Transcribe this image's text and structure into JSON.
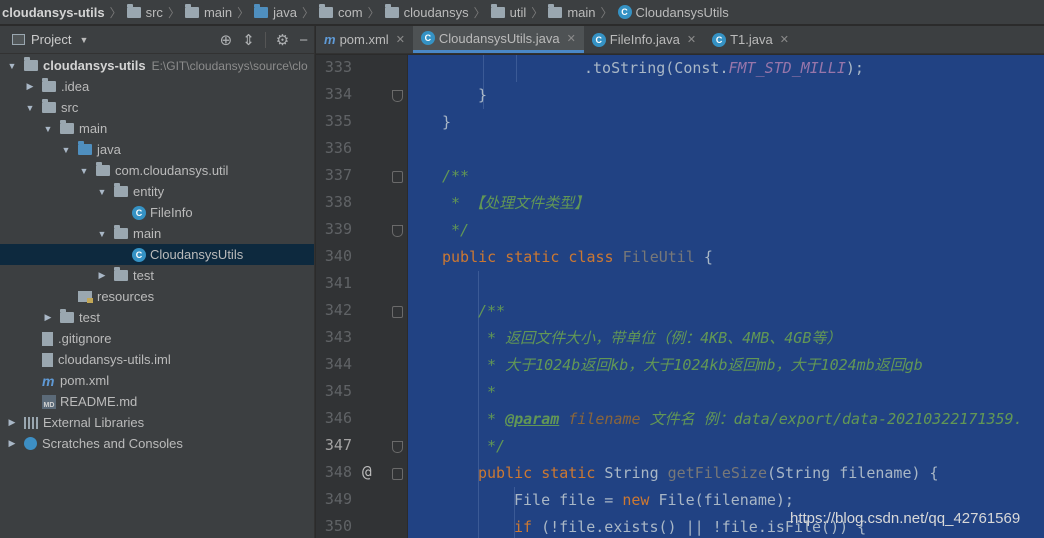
{
  "breadcrumbs": [
    {
      "label": "cloudansys-utils",
      "icon": "none"
    },
    {
      "label": "src",
      "icon": "folder-icon"
    },
    {
      "label": "main",
      "icon": "folder-icon"
    },
    {
      "label": "java",
      "icon": "folder-blue-icon"
    },
    {
      "label": "com",
      "icon": "folder-icon"
    },
    {
      "label": "cloudansys",
      "icon": "folder-icon"
    },
    {
      "label": "util",
      "icon": "folder-icon"
    },
    {
      "label": "main",
      "icon": "folder-icon"
    },
    {
      "label": "CloudansysUtils",
      "icon": "class-icon"
    }
  ],
  "project": {
    "title": "Project",
    "tree": [
      {
        "label": "cloudansys-utils",
        "path": "E:\\GIT\\cloudansys\\source\\clo",
        "bold": true,
        "arrow": "▼",
        "icon": "folder"
      },
      {
        "label": ".idea",
        "arrow": "▶",
        "icon": "folder"
      },
      {
        "label": "src",
        "arrow": "▼",
        "icon": "folder"
      },
      {
        "label": "main",
        "arrow": "▼",
        "icon": "folder"
      },
      {
        "label": "java",
        "arrow": "▼",
        "icon": "folder-blue"
      },
      {
        "label": "com.cloudansys.util",
        "arrow": "▼",
        "icon": "package"
      },
      {
        "label": "entity",
        "arrow": "▼",
        "icon": "package"
      },
      {
        "label": "FileInfo",
        "arrow": "",
        "icon": "class"
      },
      {
        "label": "main",
        "arrow": "▼",
        "icon": "package"
      },
      {
        "label": "CloudansysUtils",
        "arrow": "",
        "icon": "class"
      },
      {
        "label": "test",
        "arrow": "▶",
        "icon": "package"
      },
      {
        "label": "resources",
        "arrow": "",
        "icon": "resources"
      },
      {
        "label": "test",
        "arrow": "▶",
        "icon": "folder"
      },
      {
        "label": ".gitignore",
        "arrow": "",
        "icon": "file"
      },
      {
        "label": "cloudansys-utils.iml",
        "arrow": "",
        "icon": "file"
      },
      {
        "label": "pom.xml",
        "arrow": "",
        "icon": "maven"
      },
      {
        "label": "README.md",
        "arrow": "",
        "icon": "markdown"
      },
      {
        "label": "External Libraries",
        "arrow": "▶",
        "icon": "libraries"
      },
      {
        "label": "Scratches and Consoles",
        "arrow": "▶",
        "icon": "scratches"
      }
    ]
  },
  "tabs": [
    {
      "label": "pom.xml",
      "icon": "maven-icon",
      "active": false
    },
    {
      "label": "CloudansysUtils.java",
      "icon": "class-icon",
      "active": true
    },
    {
      "label": "FileInfo.java",
      "icon": "class-icon",
      "active": false
    },
    {
      "label": "T1.java",
      "icon": "class-icon",
      "active": false
    }
  ],
  "editor": {
    "line_numbers": [
      "333",
      "334",
      "335",
      "336",
      "337",
      "338",
      "339",
      "340",
      "341",
      "342",
      "343",
      "344",
      "345",
      "346",
      "347",
      "348",
      "349",
      "350"
    ],
    "current_line": "347",
    "lines": {
      "l333": ".toString(Const.",
      "l333b": "FMT_STD_MILLI",
      "l333c": ");",
      "l334": "}",
      "l335": "}",
      "l337": "/**",
      "l338": " * 【处理文件类型】",
      "l339": " */",
      "l340_kw": "public static class",
      "l340_cls": "FileUtil",
      "l340_end": " {",
      "l342": "/**",
      "l343": " * 返回文件大小，带单位（例：4KB、4MB、4GB等）",
      "l344": " * 大于1024b返回kb，大于1024kb返回mb，大于1024mb返回gb",
      "l345": " *",
      "l346_pre": " * ",
      "l346_tag": "@param",
      "l346_param": " filename",
      "l346_rest": " 文件名 例：data/export/data-20210322171359.",
      "l347": " */",
      "l348_kw": "public static",
      "l348_type": " String ",
      "l348_fn": "getFileSize",
      "l348_rest": "(String filename) {",
      "l349_a": "File file = ",
      "l349_kw": "new",
      "l349_b": " File(filename);",
      "l350_kw": "if",
      "l350_b": " (!file.exists() || !file.isFile()) {"
    }
  },
  "watermark": "https://blog.csdn.net/qq_42761569"
}
